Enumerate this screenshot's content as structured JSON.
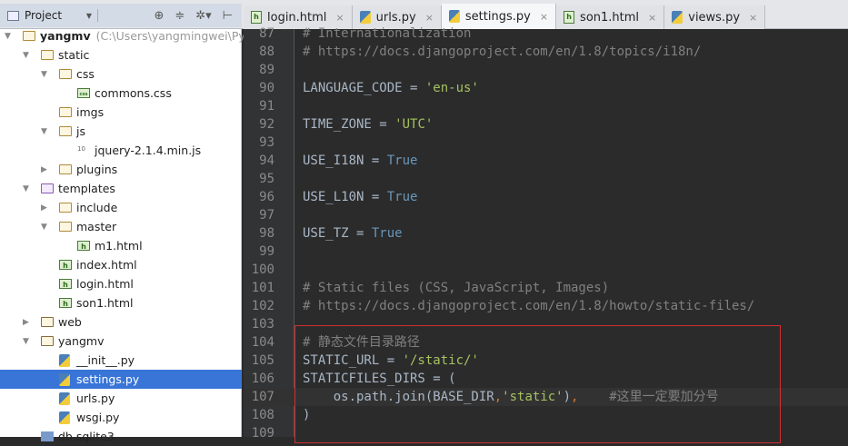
{
  "toolbar": {
    "project_label": "Project"
  },
  "tabs": [
    {
      "label": "login.html",
      "icon": "html-file-icon"
    },
    {
      "label": "urls.py",
      "icon": "python-file-icon"
    },
    {
      "label": "settings.py",
      "icon": "python-file-icon",
      "active": true
    },
    {
      "label": "son1.html",
      "icon": "html-file-icon"
    },
    {
      "label": "views.py",
      "icon": "python-file-icon"
    }
  ],
  "tree": [
    {
      "label": "yangmv",
      "path": "(C:\\Users\\yangmingwei\\Pycha",
      "level": 0,
      "type": "folder",
      "state": "open"
    },
    {
      "label": "static",
      "level": 1,
      "type": "folder",
      "state": "open"
    },
    {
      "label": "css",
      "level": 2,
      "type": "folder",
      "state": "open"
    },
    {
      "label": "commons.css",
      "level": 3,
      "type": "css"
    },
    {
      "label": "imgs",
      "level": 2,
      "type": "folder",
      "state": "none"
    },
    {
      "label": "js",
      "level": 2,
      "type": "folder",
      "state": "open"
    },
    {
      "label": "jquery-2.1.4.min.js",
      "level": 3,
      "type": "bin"
    },
    {
      "label": "plugins",
      "level": 2,
      "type": "folder",
      "state": "closed"
    },
    {
      "label": "templates",
      "level": 1,
      "type": "tpl",
      "state": "open"
    },
    {
      "label": "include",
      "level": 2,
      "type": "folder",
      "state": "closed"
    },
    {
      "label": "master",
      "level": 2,
      "type": "folder",
      "state": "open"
    },
    {
      "label": "m1.html",
      "level": 3,
      "type": "html"
    },
    {
      "label": "index.html",
      "level": 2,
      "type": "html"
    },
    {
      "label": "login.html",
      "level": 2,
      "type": "html"
    },
    {
      "label": "son1.html",
      "level": 2,
      "type": "html"
    },
    {
      "label": "web",
      "level": 1,
      "type": "mod",
      "state": "closed"
    },
    {
      "label": "yangmv",
      "level": 1,
      "type": "mod",
      "state": "open"
    },
    {
      "label": "__init__.py",
      "level": 2,
      "type": "py"
    },
    {
      "label": "settings.py",
      "level": 2,
      "type": "py",
      "selected": true
    },
    {
      "label": "urls.py",
      "level": 2,
      "type": "py"
    },
    {
      "label": "wsgi.py",
      "level": 2,
      "type": "py"
    },
    {
      "label": "db.sqlite3",
      "level": 1,
      "type": "db"
    }
  ],
  "code": [
    {
      "n": "87",
      "parts": [
        [
          "c",
          "# Internationalization"
        ]
      ]
    },
    {
      "n": "88",
      "parts": [
        [
          "c",
          "# https://docs.djangoproject.com/en/1.8/topics/i18n/"
        ]
      ]
    },
    {
      "n": "89",
      "parts": []
    },
    {
      "n": "90",
      "parts": [
        [
          "t",
          "LANGUAGE_CODE = "
        ],
        [
          "s",
          "'en-us'"
        ]
      ]
    },
    {
      "n": "91",
      "parts": []
    },
    {
      "n": "92",
      "parts": [
        [
          "t",
          "TIME_ZONE = "
        ],
        [
          "s",
          "'UTC'"
        ]
      ]
    },
    {
      "n": "93",
      "parts": []
    },
    {
      "n": "94",
      "parts": [
        [
          "t",
          "USE_I18N = "
        ],
        [
          "k",
          "True"
        ]
      ]
    },
    {
      "n": "95",
      "parts": []
    },
    {
      "n": "96",
      "parts": [
        [
          "t",
          "USE_L10N = "
        ],
        [
          "k",
          "True"
        ]
      ]
    },
    {
      "n": "97",
      "parts": []
    },
    {
      "n": "98",
      "parts": [
        [
          "t",
          "USE_TZ = "
        ],
        [
          "k",
          "True"
        ]
      ]
    },
    {
      "n": "99",
      "parts": []
    },
    {
      "n": "100",
      "parts": []
    },
    {
      "n": "101",
      "parts": [
        [
          "c",
          "# Static files (CSS, JavaScript, Images)"
        ]
      ]
    },
    {
      "n": "102",
      "parts": [
        [
          "c",
          "# https://docs.djangoproject.com/en/1.8/howto/static-files/"
        ]
      ]
    },
    {
      "n": "103",
      "parts": []
    },
    {
      "n": "104",
      "parts": [
        [
          "c",
          "# 静态文件目录路径"
        ]
      ]
    },
    {
      "n": "105",
      "parts": [
        [
          "t",
          "STATIC_URL = "
        ],
        [
          "s",
          "'/static/'"
        ]
      ]
    },
    {
      "n": "106",
      "parts": [
        [
          "t",
          "STATICFILES_DIRS = ("
        ]
      ]
    },
    {
      "n": "107",
      "parts": [
        [
          "t",
          "    os.path.join(BASE_DIR"
        ],
        [
          "p",
          ","
        ],
        [
          "s",
          "'static'"
        ],
        [
          "t",
          ")"
        ],
        [
          "p",
          ","
        ],
        [
          "t",
          "    "
        ],
        [
          "c",
          "#这里一定要加分号"
        ]
      ],
      "current": true
    },
    {
      "n": "108",
      "parts": [
        [
          "t",
          ")"
        ]
      ]
    },
    {
      "n": "109",
      "parts": []
    }
  ],
  "colors": {
    "selection": "#3875d7",
    "annotation_box": "#d03030"
  }
}
